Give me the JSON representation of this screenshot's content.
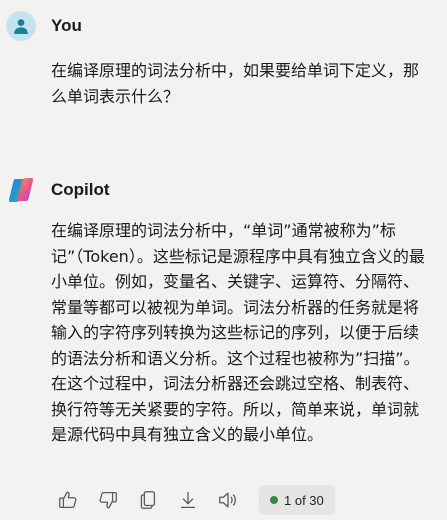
{
  "user_message": {
    "sender": "You",
    "text": "在编译原理的词法分析中，如果要给单词下定义，那么单词表示什么？"
  },
  "copilot_message": {
    "sender": "Copilot",
    "text": "在编译原理的词法分析中，“单词”通常被称为”标记”（Token）。这些标记是源程序中具有独立含义的最小单位。例如，变量名、关键字、运算符、分隔符、常量等都可以被视为单词。词法分析器的任务就是将输入的字符序列转换为这些标记的序列，以便于后续的语法分析和语义分析。这个过程也被称为”扫描”。在这个过程中，词法分析器还会跳过空格、制表符、换行符等无关紧要的字符。所以，简单来说，单词就是源代码中具有独立含义的最小单位。"
  },
  "actions": {
    "icons": [
      "thumbs-up-icon",
      "thumbs-down-icon",
      "copy-icon",
      "download-icon",
      "read-aloud-icon"
    ],
    "page_indicator": "1 of 30",
    "status_color": "#2f8a3b"
  },
  "colors": {
    "background": "#f3f2f1",
    "user_avatar_bg": "#c3e4ef",
    "user_avatar_fg": "#1a7f9a",
    "text": "#1b1b1b"
  }
}
